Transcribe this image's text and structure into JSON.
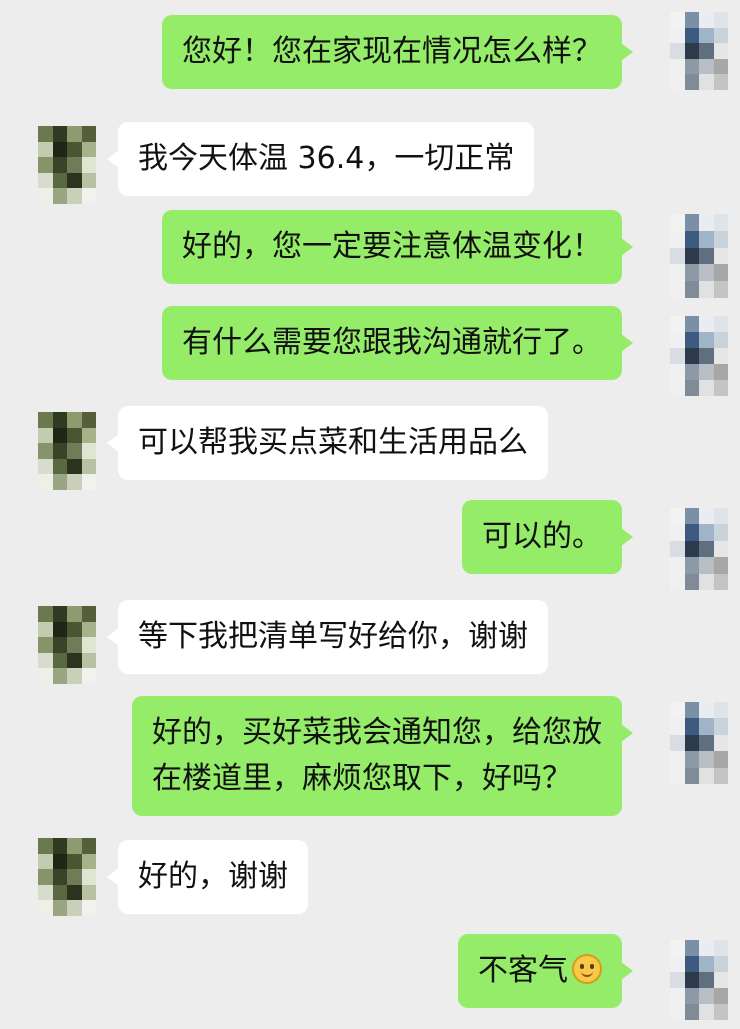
{
  "messages": [
    {
      "side": "me",
      "text": "您好！您在家现在情况怎么样？"
    },
    {
      "side": "other",
      "text": "我今天体温 36.4，一切正常"
    },
    {
      "side": "me",
      "text": "好的，您一定要注意体温变化！"
    },
    {
      "side": "me",
      "text": "有什么需要您跟我沟通就行了。"
    },
    {
      "side": "other",
      "text": "可以帮我买点菜和生活用品么"
    },
    {
      "side": "me",
      "text": "可以的。"
    },
    {
      "side": "other",
      "text": "等下我把清单写好给你，谢谢"
    },
    {
      "side": "me",
      "line1": "好的，买好菜我会通知您，给您放",
      "line2": "在楼道里，麻烦您取下，好吗？"
    },
    {
      "side": "other",
      "text": "好的，谢谢"
    },
    {
      "side": "me",
      "text": "不客气",
      "emoji": "smiley-emoji"
    }
  ],
  "colors": {
    "background": "#ededed",
    "my_bubble": "#95ec69",
    "other_bubble": "#ffffff"
  }
}
